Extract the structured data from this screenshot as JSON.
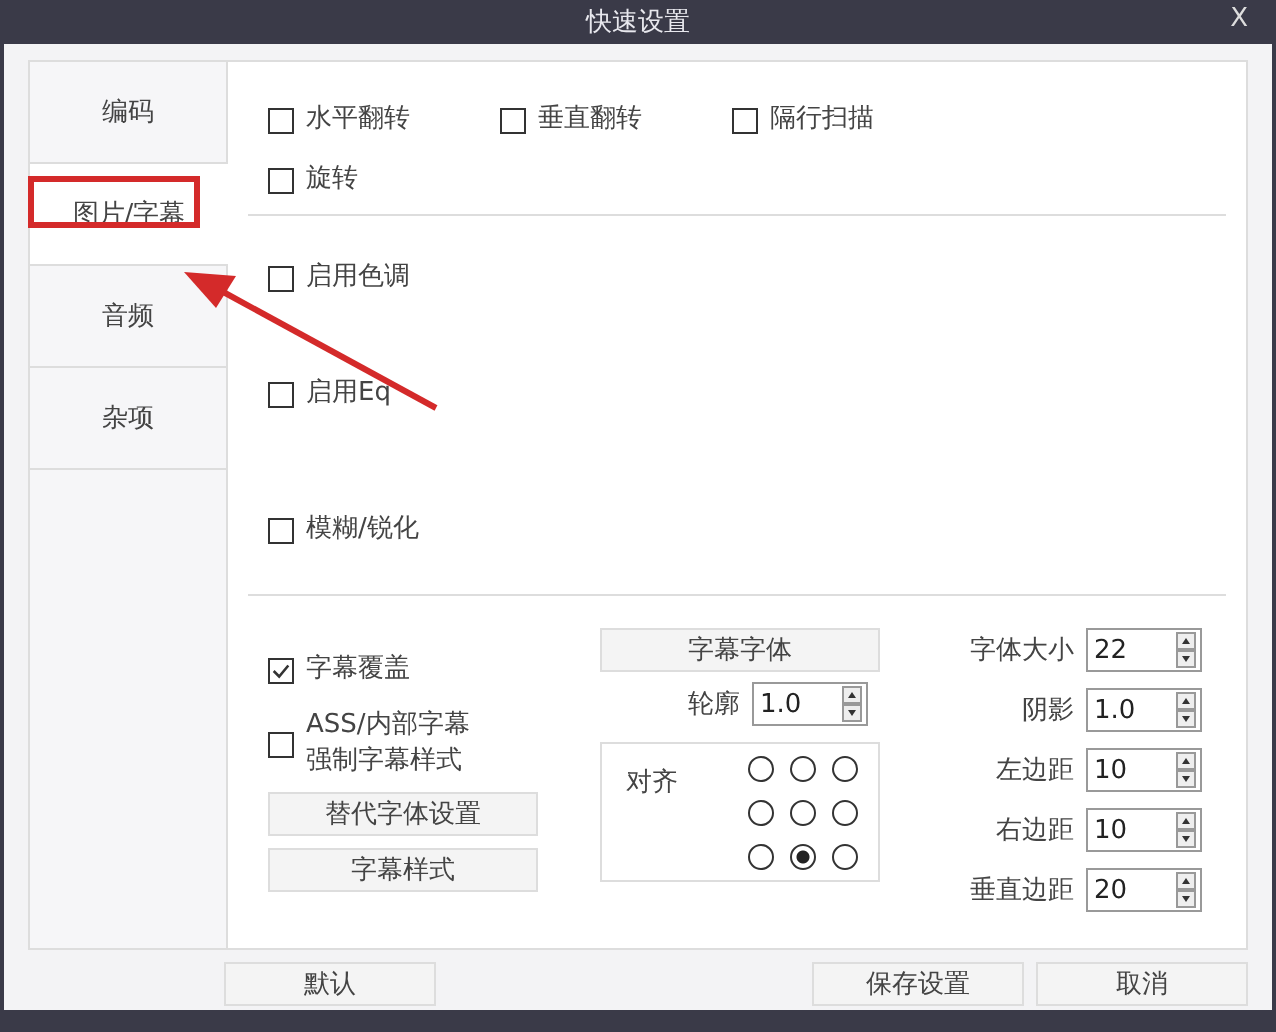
{
  "window": {
    "title": "快速设置",
    "close": "X"
  },
  "tabs": [
    {
      "label": "编码",
      "selected": false
    },
    {
      "label": "图片/字幕",
      "selected": true
    },
    {
      "label": "音频",
      "selected": false
    },
    {
      "label": "杂项",
      "selected": false
    }
  ],
  "transform_options": [
    [
      {
        "label": "水平翻转",
        "checked": false
      },
      {
        "label": "垂直翻转",
        "checked": false
      },
      {
        "label": "隔行扫描",
        "checked": false
      }
    ],
    [
      {
        "label": "旋转",
        "checked": false
      }
    ]
  ],
  "filter_options": [
    {
      "label": "启用色调",
      "checked": false
    },
    {
      "label": "启用Eq",
      "checked": false
    },
    {
      "label": "模糊/锐化",
      "checked": false
    }
  ],
  "subtitle": {
    "overlay": {
      "label": "字幕覆盖",
      "checked": true
    },
    "force_style": {
      "lines": [
        "ASS/内部字幕",
        "强制字幕样式"
      ],
      "checked": false
    },
    "buttons": [
      "替代字体设置",
      "字幕样式"
    ],
    "font_button": "字幕字体",
    "outline": {
      "label": "轮廓",
      "value": "1.0"
    },
    "align": {
      "label": "对齐",
      "options": [
        {
          "selected": false
        },
        {
          "selected": false
        },
        {
          "selected": false
        },
        {
          "selected": false
        },
        {
          "selected": false
        },
        {
          "selected": false
        },
        {
          "selected": false
        },
        {
          "selected": true
        },
        {
          "selected": false
        }
      ]
    },
    "spinners": [
      {
        "label": "字体大小",
        "value": "22"
      },
      {
        "label": "阴影",
        "value": "1.0"
      },
      {
        "label": "左边距",
        "value": "10"
      },
      {
        "label": "右边距",
        "value": "10"
      },
      {
        "label": "垂直边距",
        "value": "20"
      }
    ]
  },
  "footer": {
    "default": "默认",
    "save": "保存设置",
    "cancel": "取消"
  }
}
